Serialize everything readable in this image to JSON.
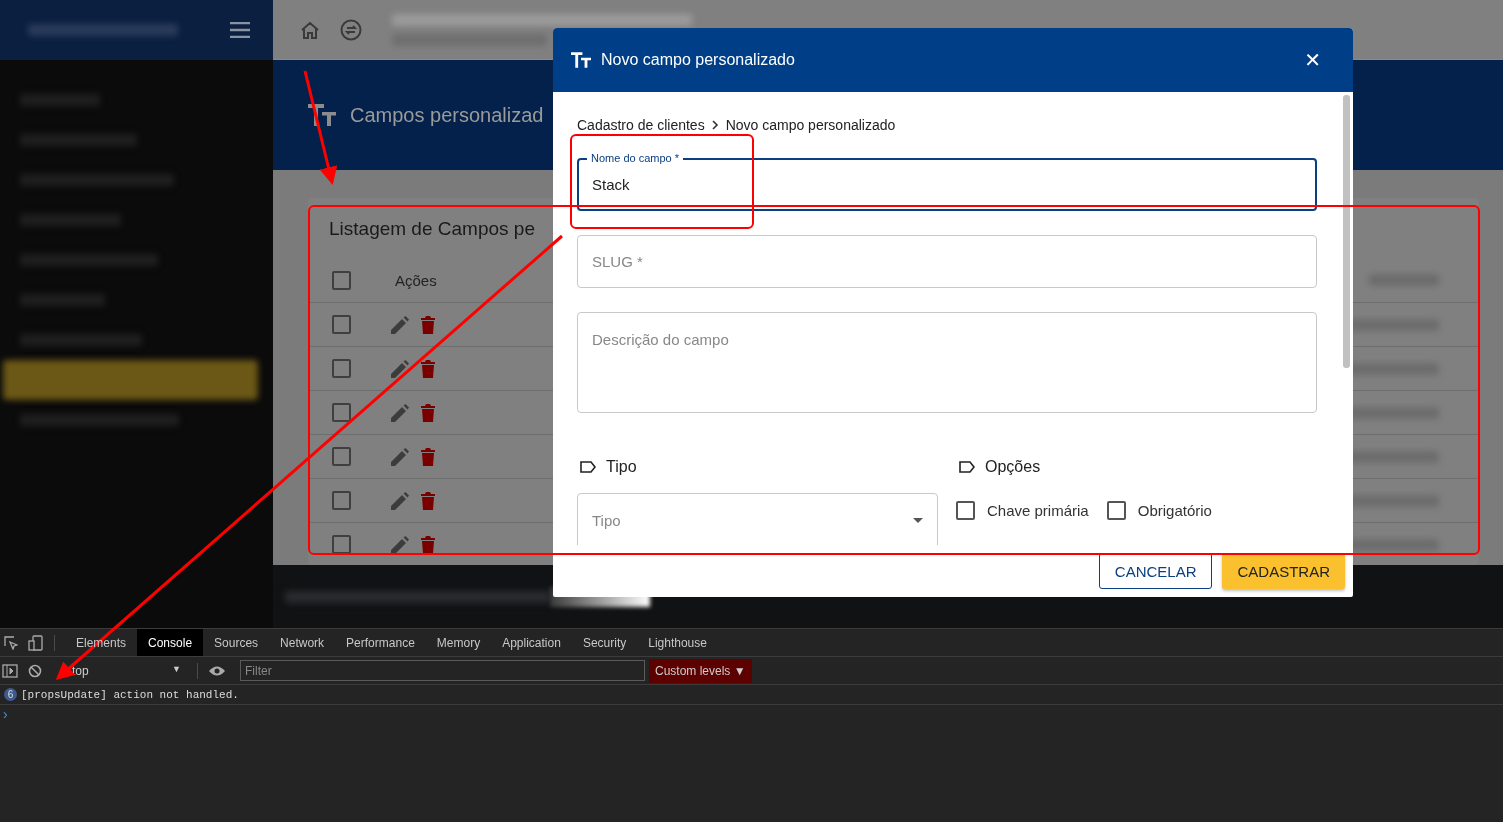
{
  "page_header": {
    "title": "Campos personalizad"
  },
  "listing": {
    "title": "Listagem de Campos pe",
    "header_checked": false,
    "action_column": "Ações",
    "rows": [
      {
        "checked": false
      },
      {
        "checked": false
      },
      {
        "checked": false
      },
      {
        "checked": false
      },
      {
        "checked": false
      },
      {
        "checked": false
      }
    ]
  },
  "modal": {
    "title": "Novo campo personalizado",
    "close": "✕",
    "breadcrumb": [
      "Cadastro de clientes",
      "Novo campo personalizado"
    ],
    "fields": [
      {
        "kind": "text",
        "label": "Nome do campo *",
        "value": "Stack",
        "focused": true
      },
      {
        "kind": "text",
        "placeholder": "SLUG *",
        "focused": false
      },
      {
        "kind": "textarea",
        "placeholder": "Descrição do campo",
        "focused": false
      }
    ],
    "type_section": {
      "heading": "Tipo",
      "placeholder": "Tipo"
    },
    "options_section": {
      "heading": "Opções",
      "checkboxes": [
        {
          "label": "Chave primária",
          "checked": false
        },
        {
          "label": "Obrigatório",
          "checked": false
        }
      ]
    },
    "buttons": [
      {
        "label": "CANCELAR",
        "kind": "outlined"
      },
      {
        "label": "CADASTRAR",
        "kind": "primary"
      }
    ]
  },
  "devtools": {
    "tabs": [
      {
        "label": "Elements",
        "selected": false
      },
      {
        "label": "Console",
        "selected": true
      },
      {
        "label": "Sources",
        "selected": false
      },
      {
        "label": "Network",
        "selected": false
      },
      {
        "label": "Performance",
        "selected": false
      },
      {
        "label": "Memory",
        "selected": false
      },
      {
        "label": "Application",
        "selected": false
      },
      {
        "label": "Security",
        "selected": false
      },
      {
        "label": "Lighthouse",
        "selected": false
      }
    ],
    "context": "top",
    "context_caret": "▼",
    "filter_placeholder": "Filter",
    "levels": "Custom levels",
    "levels_caret": "▼",
    "messages": [
      {
        "count": "6",
        "text": "[propsUpdate] action not handled."
      }
    ],
    "prompt": "›"
  }
}
